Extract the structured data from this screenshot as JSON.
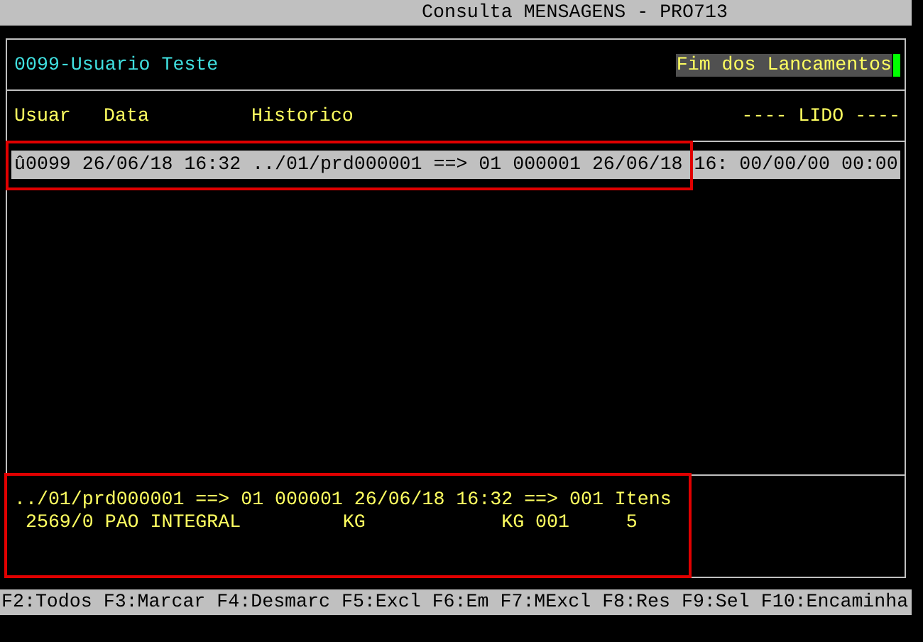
{
  "window": {
    "title": "Consulta MENSAGENS - PRO713"
  },
  "header": {
    "user": "0099-Usuario Teste",
    "status": "Fim dos Lancamentos",
    "cursor": true
  },
  "columns": [
    {
      "label": "Usuar"
    },
    {
      "label": "Data"
    },
    {
      "label": "Historico"
    },
    {
      "label": "---- LIDO ----"
    }
  ],
  "rows": [
    {
      "text": "û0099 26/06/18 16:32 ../01/prd000001 ==> 01 000001 26/06/18 16: 00/00/00 00:00",
      "selected": true
    }
  ],
  "detail": [
    "../01/prd000001 ==> 01 000001 26/06/18 16:32 ==> 001 Itens",
    " 2569/0 PAO INTEGRAL         KG            KG 001     5"
  ],
  "function_keys": [
    "F2:Todos",
    "F3:Marcar",
    "F4:Desmarc",
    "F5:Excl",
    "F6:Em",
    "F7:MExcl",
    "F8:Res",
    "F9:Sel",
    "F10:Encaminha"
  ]
}
